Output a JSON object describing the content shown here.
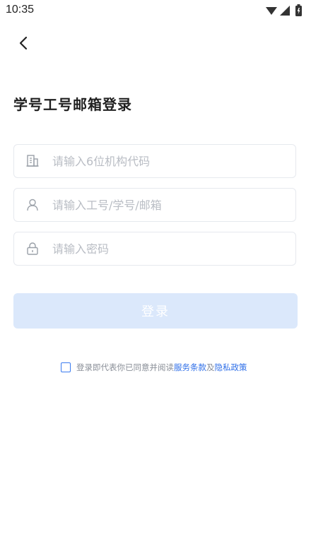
{
  "status_bar": {
    "time": "10:35",
    "icons": [
      "wifi-icon",
      "cell-signal-icon",
      "battery-icon"
    ]
  },
  "header": {
    "back_icon": "chevron-left-icon",
    "title": "学号工号邮箱登录"
  },
  "form": {
    "org_code": {
      "placeholder": "请输入6位机构代码",
      "value": "",
      "icon": "building-icon"
    },
    "account": {
      "placeholder": "请输入工号/学号/邮箱",
      "value": "",
      "icon": "user-icon"
    },
    "password": {
      "placeholder": "请输入密码",
      "value": "",
      "icon": "lock-icon"
    },
    "login_label": "登录"
  },
  "agreement": {
    "checked": false,
    "prefix": "登录即代表你已同意并阅读",
    "terms_link": "服务条款",
    "and": "及",
    "privacy_link": "隐私政策"
  },
  "colors": {
    "accent": "#2f6fe8",
    "button_disabled_bg": "#dbe8fb",
    "placeholder": "#b9bdc4",
    "border": "#e6e9ee"
  }
}
